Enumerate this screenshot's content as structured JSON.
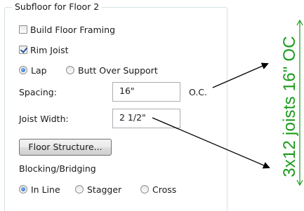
{
  "group": {
    "title": "Subfloor for Floor 2"
  },
  "options": {
    "build_floor_framing": {
      "label": "Build Floor Framing",
      "checked": false
    },
    "rim_joist": {
      "label": "Rim Joist",
      "checked": true
    }
  },
  "joint_type": {
    "options": [
      {
        "label": "Lap",
        "selected": true
      },
      {
        "label": "Butt Over Support",
        "selected": false
      }
    ]
  },
  "spacing": {
    "label": "Spacing:",
    "value": "16\"",
    "suffix": "O.C."
  },
  "joist_width": {
    "label": "Joist Width:",
    "value": "2 1/2\""
  },
  "floor_structure_button": {
    "label": "Floor Structure..."
  },
  "blocking": {
    "label": "Blocking/Bridging",
    "options": [
      {
        "label": "In Line",
        "selected": true
      },
      {
        "label": "Stagger",
        "selected": false
      },
      {
        "label": "Cross",
        "selected": false
      }
    ]
  },
  "annotation": {
    "text": "3x12 joists 16\" OC",
    "color": "#1a9b1a",
    "arrow_color": "#000000"
  }
}
